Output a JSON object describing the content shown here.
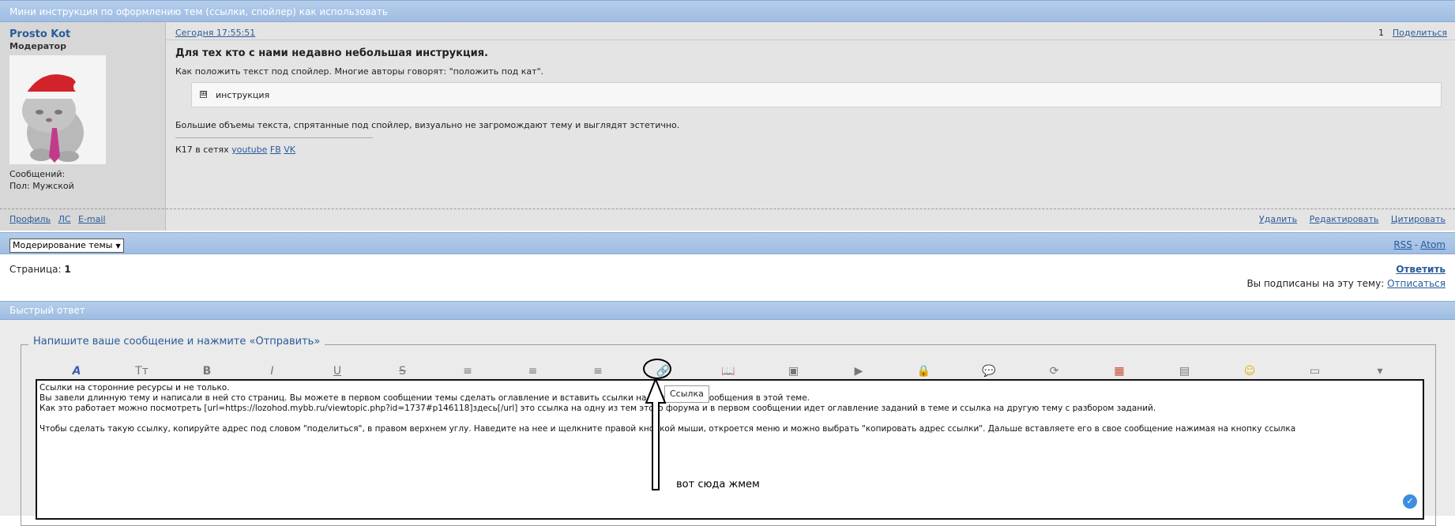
{
  "topic": {
    "title": "Мини инструкция по оформлению тем (ссылки, спойлер) как использовать"
  },
  "author": {
    "name": "Prosto Kot",
    "role": "Модератор",
    "posts_label": "Сообщений:",
    "gender_label": "Пол: Мужской"
  },
  "post": {
    "date": "Сегодня 17:55:51",
    "number": "1",
    "share": "Поделиться",
    "title": "Для тех кто с нами недавно небольшая инструкция.",
    "paragraph1": "Как положить текст под спойлер. Многие авторы говорят: \"положить под кат\".",
    "spoiler_title": "инструкция",
    "spoiler_icon": "⊞",
    "paragraph2": "Большие объемы текста, спрятанные под спойлер, визуально не загромождают тему и выглядят эстетично.",
    "signature_prefix": "К17 в сетях",
    "signature_links": [
      "youtube",
      "FB",
      "VK"
    ]
  },
  "post_footer": {
    "left": [
      "Профиль",
      "ЛС",
      "E-mail"
    ],
    "right": [
      "Удалить",
      "Редактировать",
      "Цитировать"
    ]
  },
  "moderation": {
    "select_value": "Модерирование темы",
    "rss": "RSS",
    "atom": "Atom",
    "sep": "-"
  },
  "pages": {
    "label": "Страница:",
    "current": "1"
  },
  "reply_link": "Ответить",
  "subscription": {
    "text": "Вы подписаны на эту тему:",
    "link": "Отписаться"
  },
  "quick_reply": {
    "title": "Быстрый ответ",
    "legend": "Напишите ваше сообщение и нажмите «Отправить»",
    "toolbar": [
      {
        "name": "font-color-icon",
        "glyph": "A"
      },
      {
        "name": "font-size-icon",
        "glyph": "Tт"
      },
      {
        "name": "bold-icon",
        "glyph": "B"
      },
      {
        "name": "italic-icon",
        "glyph": "I"
      },
      {
        "name": "underline-icon",
        "glyph": "U"
      },
      {
        "name": "strike-icon",
        "glyph": "S"
      },
      {
        "name": "align-left-icon",
        "glyph": "≡"
      },
      {
        "name": "align-center-icon",
        "glyph": "≡"
      },
      {
        "name": "align-right-icon",
        "glyph": "≡"
      },
      {
        "name": "link-icon",
        "glyph": "🔗"
      },
      {
        "name": "book-icon",
        "glyph": "📖"
      },
      {
        "name": "image-icon",
        "glyph": "▣"
      },
      {
        "name": "video-icon",
        "glyph": "▶"
      },
      {
        "name": "lock-icon",
        "glyph": "🔒"
      },
      {
        "name": "quote-icon",
        "glyph": "💬"
      },
      {
        "name": "refresh-icon",
        "glyph": "⟳"
      },
      {
        "name": "colors-icon",
        "glyph": "▦"
      },
      {
        "name": "table-icon",
        "glyph": "▤"
      },
      {
        "name": "smile-icon",
        "glyph": "☺"
      },
      {
        "name": "folder-icon",
        "glyph": "▭"
      },
      {
        "name": "more-icon",
        "glyph": "▾"
      }
    ],
    "tooltip": "Ссылка",
    "text_lines": [
      "Ссылки на сторонние ресурсы и не только.",
      "Вы завели длинную тему и написали в ней сто страниц. Вы можете в первом сообщении темы сделать оглавление и вставить ссылки на конкретные сообщения в этой теме.",
      "Как это работает можно посмотреть [url=https://lozohod.mybb.ru/viewtopic.php?id=1737#p146118]здесь[/url] это ссылка на одну из тем этого форума и в первом сообщении идет оглавление заданий в теме и ссылка на другую тему с разбором заданий.",
      "",
      "Чтобы сделать такую ссылку, копируйте адрес под словом \"поделиться\", в правом верхнем углу. Наведите на нее и щелкните правой кнопкой мыши, откроется меню и можно выбрать \"копировать адрес ссылки\". Дальше вставляете его в свое сообщение нажимая на кнопку ссылка"
    ],
    "annotation": "вот сюда жмем"
  },
  "colors": {
    "accent": "#2a5b9a",
    "bar": "#a9c4e6",
    "post_bg": "#e4e4e4"
  }
}
